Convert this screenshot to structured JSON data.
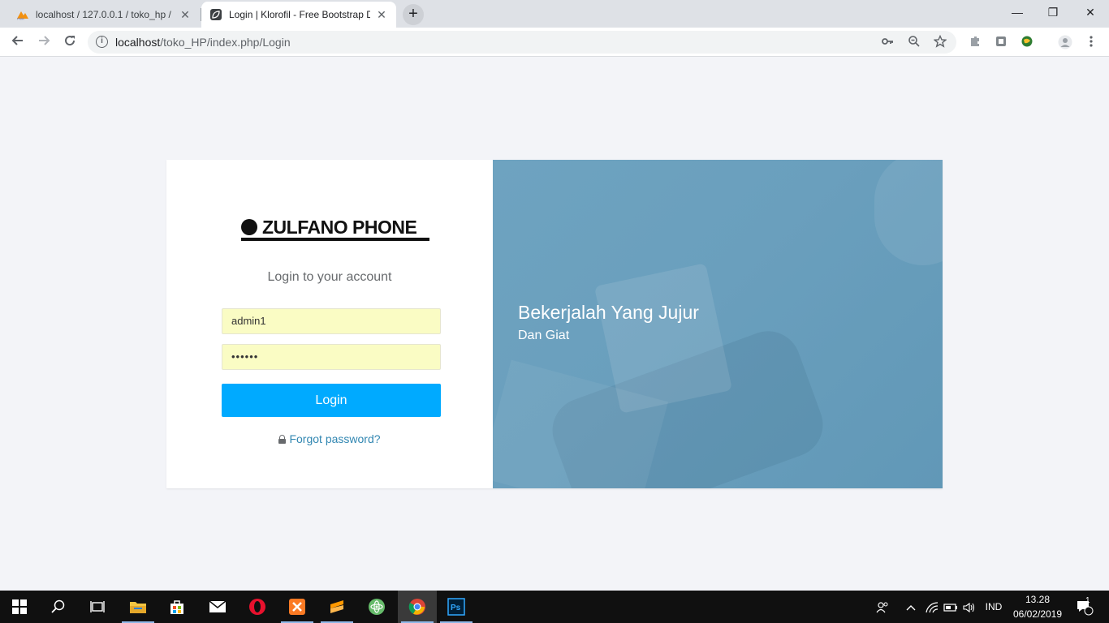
{
  "browser": {
    "tabs": [
      {
        "title": "localhost / 127.0.0.1 / toko_hp / t",
        "favicon": "phpmyadmin-icon",
        "active": false
      },
      {
        "title": "Login | Klorofil - Free Bootstrap D",
        "favicon": "klorofil-leaf-icon",
        "active": true
      }
    ],
    "new_tab_label": "+",
    "close_glyph": "✕",
    "window_controls": {
      "minimize": "—",
      "restore": "❐",
      "close": "✕"
    },
    "url_host": "localhost",
    "url_path": "/toko_HP/index.php/Login"
  },
  "login": {
    "brand": "ZULFANO PHONE",
    "subtitle": "Login to your account",
    "username_value": "admin1",
    "password_value": "••••••",
    "button_label": "Login",
    "forgot_label": "Forgot password?"
  },
  "hero": {
    "headline": "Bekerjalah Yang Jujur",
    "tagline": "Dan Giat"
  },
  "taskbar": {
    "language": "IND",
    "time": "13.28",
    "date": "06/02/2019",
    "notification_count": "1"
  },
  "colors": {
    "accent": "#00aaff",
    "link": "#3287b2",
    "hero_overlay": "#6ea3c0",
    "autofill": "#fafcc4"
  }
}
